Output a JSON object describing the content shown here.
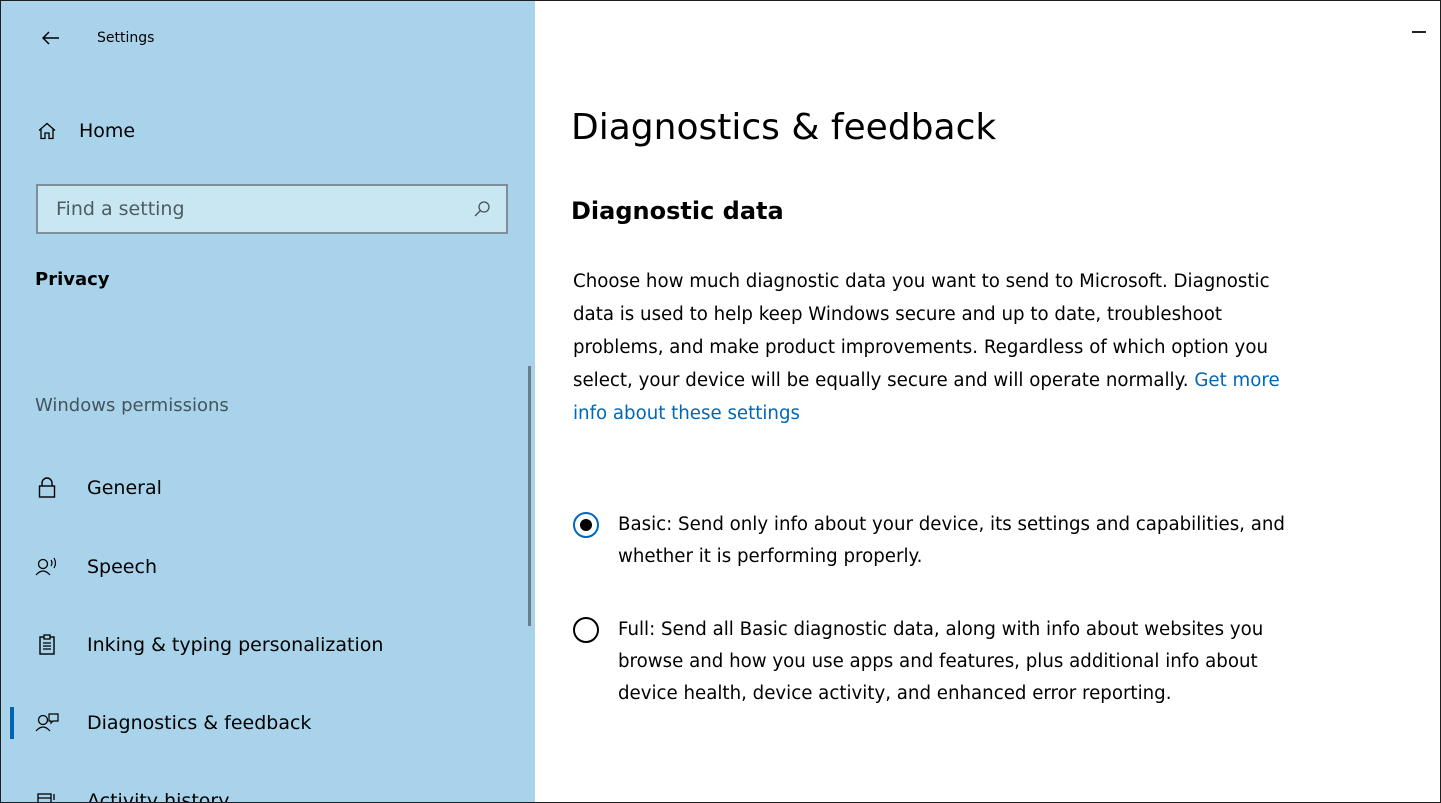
{
  "window": {
    "app_title": "Settings"
  },
  "sidebar": {
    "home_label": "Home",
    "search_placeholder": "Find a setting",
    "section_title": "Privacy",
    "group_label": "Windows permissions",
    "items": [
      {
        "label": "General",
        "icon": "lock-icon"
      },
      {
        "label": "Speech",
        "icon": "speech-icon"
      },
      {
        "label": "Inking & typing personalization",
        "icon": "clipboard-icon"
      },
      {
        "label": "Diagnostics & feedback",
        "icon": "feedback-icon",
        "active": true
      },
      {
        "label": "Activity history",
        "icon": "activity-history-icon"
      }
    ]
  },
  "main": {
    "title": "Diagnostics & feedback",
    "subtitle": "Diagnostic data",
    "description": "Choose how much diagnostic data you want to send to Microsoft. Diagnostic data is used to help keep Windows secure and up to date, troubleshoot problems, and make product improvements. Regardless of which option you select, your device will be equally secure and will operate normally. ",
    "link_text": "Get more info about these settings",
    "options": [
      {
        "label": "Basic: Send only info about your device, its settings and capabilities, and whether it is performing properly.",
        "selected": true
      },
      {
        "label": "Full: Send all Basic diagnostic data, along with info about websites you browse and how you use apps and features, plus additional info about device health, device activity, and enhanced error reporting.",
        "selected": false
      }
    ]
  },
  "colors": {
    "sidebar_bg": "#a9d3ea",
    "accent": "#0067b8",
    "active_indicator": "#0063b1"
  }
}
